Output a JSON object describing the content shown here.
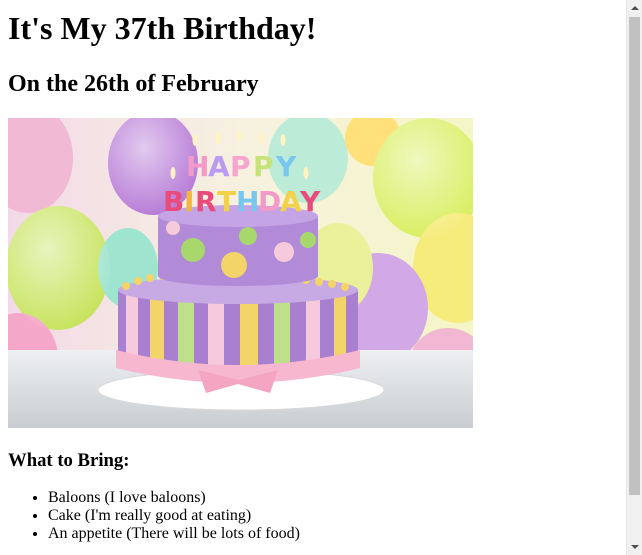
{
  "page": {
    "title": "It's My 37th Birthday!",
    "subtitle": "On the 26th of February"
  },
  "image": {
    "description_icon": "birthday-cake-image"
  },
  "bring": {
    "heading": "What to Bring:",
    "items": [
      "Baloons (I love baloons)",
      "Cake (I'm really good at eating)",
      "An appetite (There will be lots of food)"
    ]
  },
  "colors": {
    "background": "#ffffff",
    "text": "#000000",
    "scrollbar_track": "#f0f0f0",
    "scrollbar_thumb": "#c1c1c1"
  }
}
